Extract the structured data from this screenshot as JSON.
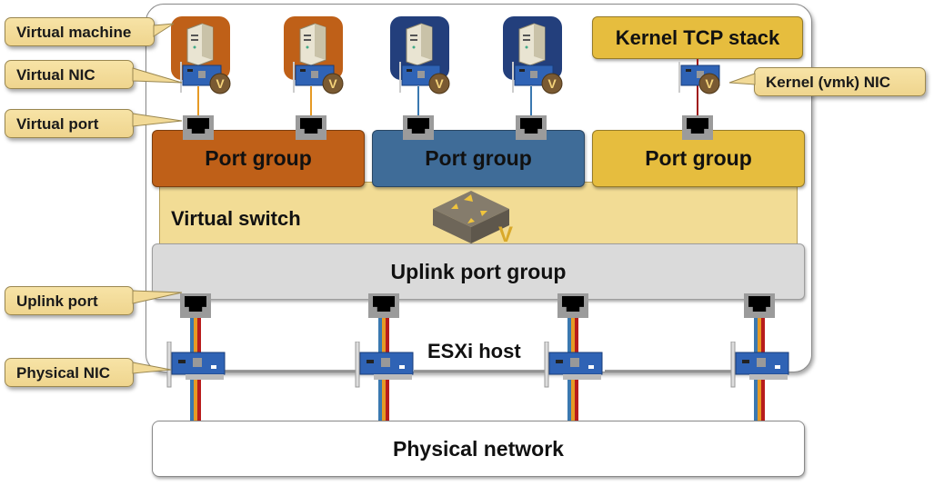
{
  "diagram": {
    "host_label": "ESXi host",
    "virtual_switch_label": "Virtual switch",
    "uplink_port_group_label": "Uplink port group",
    "physical_network_label": "Physical network",
    "kernel_tcp_stack_label": "Kernel TCP stack",
    "port_groups": [
      {
        "label": "Port group",
        "color": "#bf6018"
      },
      {
        "label": "Port group",
        "color": "#3f6c98"
      },
      {
        "label": "Port group",
        "color": "#e6bd3e"
      }
    ],
    "virtual_machines": [
      {
        "group": "orange",
        "color": "#bf6018"
      },
      {
        "group": "orange",
        "color": "#bf6018"
      },
      {
        "group": "blue",
        "color": "#233f7c"
      },
      {
        "group": "blue",
        "color": "#233f7c"
      }
    ],
    "uplink_port_count": 4,
    "physical_nic_count": 4,
    "callouts": {
      "virtual_machine": "Virtual machine",
      "virtual_nic": "Virtual NIC",
      "virtual_port": "Virtual port",
      "uplink_port": "Uplink port",
      "physical_nic": "Physical NIC",
      "kernel_nic": "Kernel (vmk) NIC"
    },
    "badge_letter": "V",
    "colors": {
      "orange": "#bf6018",
      "blue": "#3f6c98",
      "navy": "#233f7c",
      "yellow": "#e6bd3e",
      "switch_bg": "#f2dc95",
      "uplink_bg": "#dadada",
      "callout_bg": "#f5df9f"
    }
  }
}
